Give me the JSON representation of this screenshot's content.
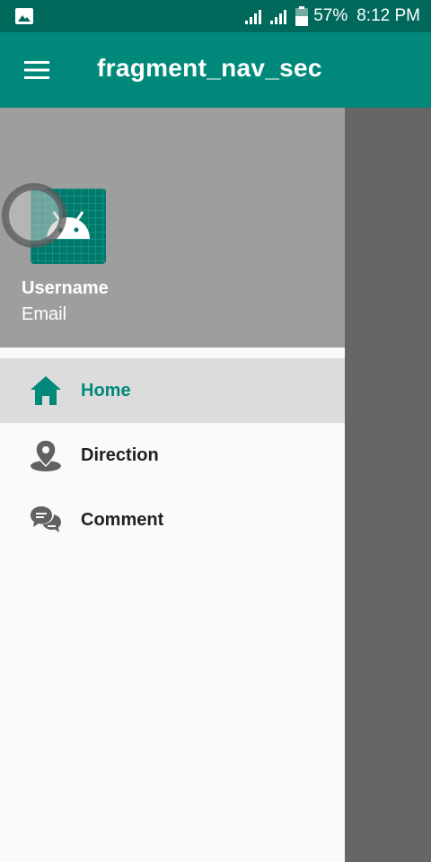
{
  "status_bar": {
    "battery_text": "57%",
    "time": "8:12 PM"
  },
  "app_bar": {
    "title": "fragment_nav_sec",
    "menu_icon": "hamburger-menu-icon"
  },
  "drawer": {
    "header": {
      "username": "Username",
      "email": "Email",
      "avatar_icon": "android-avatar-icon"
    },
    "items": [
      {
        "label": "Home",
        "icon": "home-icon",
        "active": true
      },
      {
        "label": "Direction",
        "icon": "location-pin-icon",
        "active": false
      },
      {
        "label": "Comment",
        "icon": "comment-icon",
        "active": false
      }
    ]
  },
  "colors": {
    "status_bar": "#00695c",
    "primary": "#00897b",
    "header_bg": "#9e9e9e",
    "scrim": "#666666",
    "active_item_bg": "#dcdcdc"
  }
}
